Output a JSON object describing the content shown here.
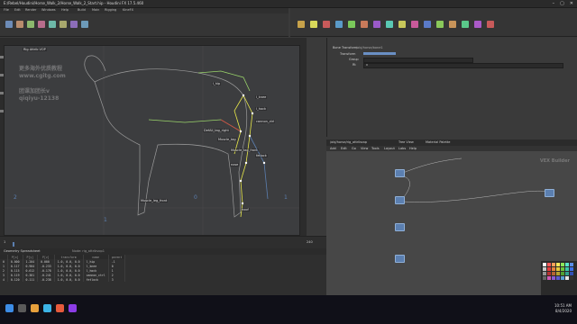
{
  "window": {
    "title": "E:/Rebel/Houdini/Horse_Walk_2/Horse_Walk_2_Start.hip - Houdini FX 17.5.460"
  },
  "menu": [
    "File",
    "Edit",
    "Render",
    "Windows",
    "Help",
    "Build",
    "Main",
    "Rigging",
    "KineFX"
  ],
  "viewport": {
    "name": "Rig Attrib VOP",
    "axis_labels": [
      "2",
      "1",
      "0",
      "1"
    ],
    "joint_labels": [
      "l_hip",
      "l_knee",
      "l_hock",
      "cannon_ctrl",
      "fetlock",
      "hoof",
      "DefAll_tag_right",
      "Muscle_tag",
      "Muscle_tag_front",
      "nose",
      "Muscle_leg_front"
    ]
  },
  "watermark": {
    "line1": "更多海外优质教程",
    "line2": "www.cgitg.com",
    "line3": "团课加团长v",
    "line4": "qiqiyu-12138"
  },
  "params": {
    "node_label": "Bone Transform",
    "node_value": "/obj/horse/bone1",
    "labels": [
      "Transform",
      "Group",
      "Rt"
    ],
    "rt_value": "0"
  },
  "network": {
    "tabs": [
      "/obj/horse/rig_attribvop",
      "Tree View",
      "Material Palette"
    ],
    "menu": [
      "Add",
      "Edit",
      "Go",
      "View",
      "Tools",
      "Layout",
      "Labs",
      "Help"
    ],
    "builder_label": "VEX Builder"
  },
  "spreadsheet": {
    "tab": "Geometry Spreadsheet",
    "path": "Node: rig_attribvop1",
    "columns": [
      "",
      "P[x]",
      "P[y]",
      "P[z]",
      "transform",
      "name",
      "parent"
    ],
    "rows": [
      [
        "0",
        "0.000",
        "1.204",
        "0.000",
        "1.0, 0.0, 0.0",
        "l_hip",
        "-1"
      ],
      [
        "1",
        "0.117",
        "0.904",
        "-0.233",
        "1.0, 0.0, 0.0",
        "l_knee",
        "0"
      ],
      [
        "2",
        "0.115",
        "0.612",
        "-0.178",
        "1.0, 0.0, 0.0",
        "l_hock",
        "1"
      ],
      [
        "3",
        "0.119",
        "0.381",
        "-0.241",
        "1.0, 0.0, 0.0",
        "cannon_ctrl",
        "2"
      ],
      [
        "4",
        "0.120",
        "0.111",
        "-0.238",
        "1.0, 0.0, 0.0",
        "fetlock",
        "3"
      ]
    ]
  },
  "timeline": {
    "start": "1",
    "end": "240",
    "current": "1"
  },
  "taskbar": {
    "time": "10:51 AM",
    "date": "8/4/2020"
  },
  "colors": {
    "accent": "#5b7fb0",
    "skeleton": "#e8e84a",
    "bone": "#9ad46a",
    "spine_red": "#d24040"
  }
}
